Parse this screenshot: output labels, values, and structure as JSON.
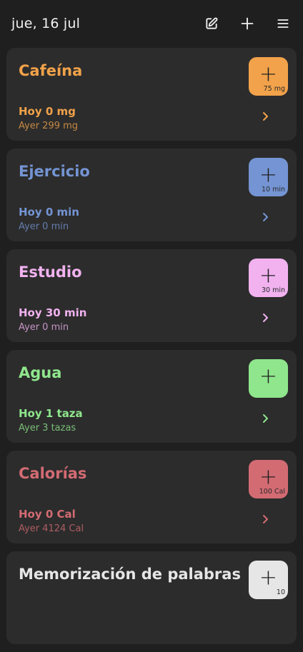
{
  "header": {
    "date": "jue, 16 jul"
  },
  "cards": [
    {
      "title": "Cafeína",
      "today": "Hoy 0 mg",
      "yesterday": "Ayer 299 mg",
      "button_amount": "75 mg",
      "color": "#f2a24a"
    },
    {
      "title": "Ejercicio",
      "today": "Hoy 0 min",
      "yesterday": "Ayer 0 min",
      "button_amount": "10 min",
      "color": "#7494d3"
    },
    {
      "title": "Estudio",
      "today": "Hoy 30 min",
      "yesterday": "Ayer 0 min",
      "button_amount": "30 min",
      "color": "#f1b2ef"
    },
    {
      "title": "Agua",
      "today": "Hoy 1 taza",
      "yesterday": "Ayer 3 tazas",
      "button_amount": "",
      "color": "#8fe68c"
    },
    {
      "title": "Calorías",
      "today": "Hoy 0 Cal",
      "yesterday": "Ayer 4124 Cal",
      "button_amount": "100 Cal",
      "color": "#d36b73"
    },
    {
      "title": "Memorización de palabras",
      "today": "",
      "yesterday": "",
      "button_amount": "10",
      "color": "#e6e6e6"
    }
  ],
  "icons": {
    "edit": "edit-icon",
    "add": "plus-icon",
    "menu": "menu-icon",
    "chevron": "chevron-right-icon"
  }
}
